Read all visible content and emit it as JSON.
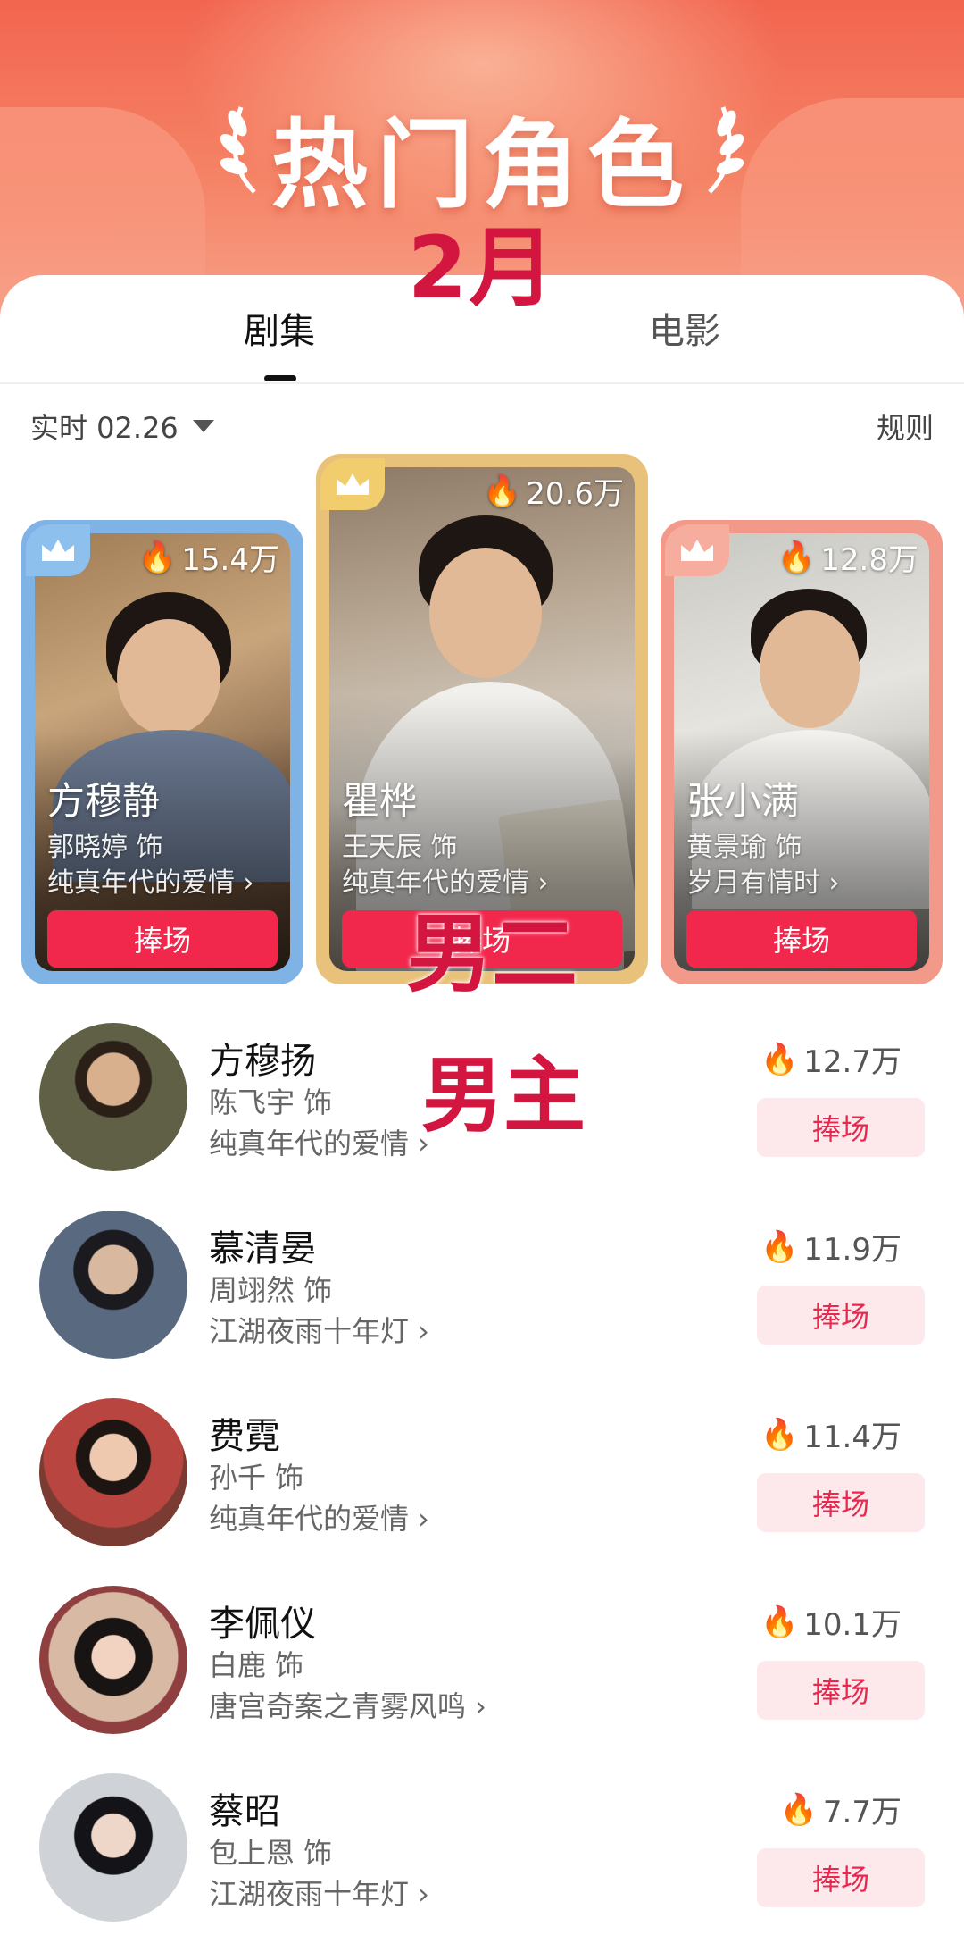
{
  "header": {
    "title": "热门角色",
    "month_overlay": "2月"
  },
  "tabs": [
    {
      "label": "剧集",
      "active": true
    },
    {
      "label": "电影",
      "active": false
    }
  ],
  "filter": {
    "date_label": "实时 02.26",
    "rules_label": "规则"
  },
  "top3": [
    {
      "rank": 1,
      "heat": "20.6万",
      "name": "瞿桦",
      "actor": "王天辰 饰",
      "drama": "纯真年代的爱情 ›",
      "button": "捧场"
    },
    {
      "rank": 2,
      "heat": "15.4万",
      "name": "方穆静",
      "actor": "郭晓婷 饰",
      "drama": "纯真年代的爱情 ›",
      "button": "捧场"
    },
    {
      "rank": 3,
      "heat": "12.8万",
      "name": "张小满",
      "actor": "黄景瑜 饰",
      "drama": "岁月有情时 ›",
      "button": "捧场"
    }
  ],
  "overlays": {
    "second_male": "男二",
    "male_lead": "男主"
  },
  "list": [
    {
      "name": "方穆扬",
      "actor": "陈飞宇 饰",
      "drama": "纯真年代的爱情 ›",
      "heat": "12.7万",
      "button": "捧场"
    },
    {
      "name": "慕清晏",
      "actor": "周翊然 饰",
      "drama": "江湖夜雨十年灯 ›",
      "heat": "11.9万",
      "button": "捧场"
    },
    {
      "name": "费霓",
      "actor": "孙千 饰",
      "drama": "纯真年代的爱情 ›",
      "heat": "11.4万",
      "button": "捧场"
    },
    {
      "name": "李佩仪",
      "actor": "白鹿 饰",
      "drama": "唐宫奇案之青雾风鸣 ›",
      "heat": "10.1万",
      "button": "捧场"
    },
    {
      "name": "蔡昭",
      "actor": "包上恩 饰",
      "drama": "江湖夜雨十年灯 ›",
      "heat": "7.7万",
      "button": "捧场"
    }
  ],
  "colors": {
    "accent": "#f2274c",
    "overlay_red": "#d21640",
    "silver_frame": "#7fb3e6",
    "gold_frame": "#e8c27a",
    "bronze_frame": "#f2998a"
  },
  "icons": [
    "crown-icon",
    "flame-icon",
    "caret-down-icon",
    "laurel-icon"
  ]
}
